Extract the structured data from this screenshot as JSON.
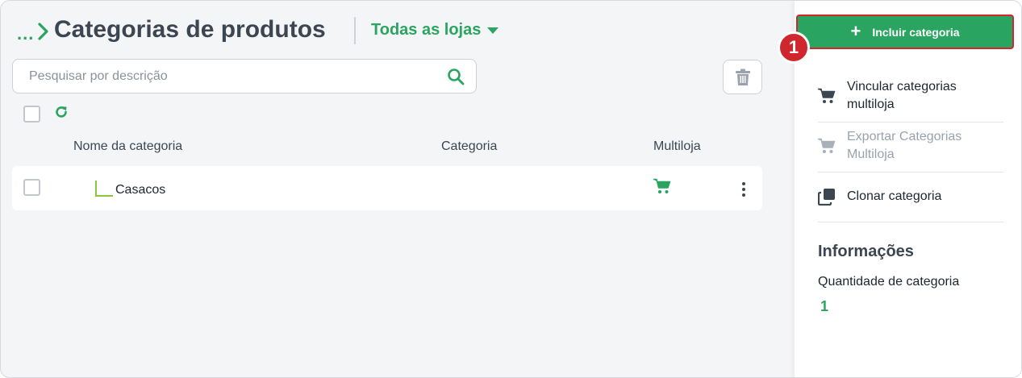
{
  "header": {
    "breadcrumb_ellipsis": "...",
    "title": "Categorias de produtos",
    "store_selector": "Todas as lojas"
  },
  "search": {
    "placeholder": "Pesquisar por descrição"
  },
  "table": {
    "columns": [
      "Nome da categoria",
      "Categoria",
      "Multiloja"
    ],
    "rows": [
      {
        "name": "Casacos",
        "category": "",
        "multiloja": "cart-icon"
      }
    ]
  },
  "sidebar": {
    "add_button": "Incluir categoria",
    "step_badge": "1",
    "menu": [
      {
        "label": "Vincular categorias multiloja",
        "icon": "cart-icon",
        "enabled": true
      },
      {
        "label": "Exportar Categorias Multiloja",
        "icon": "cart-icon",
        "enabled": false
      },
      {
        "label": "Clonar categoria",
        "icon": "clone-icon",
        "enabled": true
      }
    ],
    "info": {
      "title": "Informações",
      "label": "Quantidade de categoria",
      "value": "1"
    }
  },
  "colors": {
    "accent": "#2aa561",
    "highlight": "#d0272e",
    "tree_line": "#8cc63f"
  }
}
